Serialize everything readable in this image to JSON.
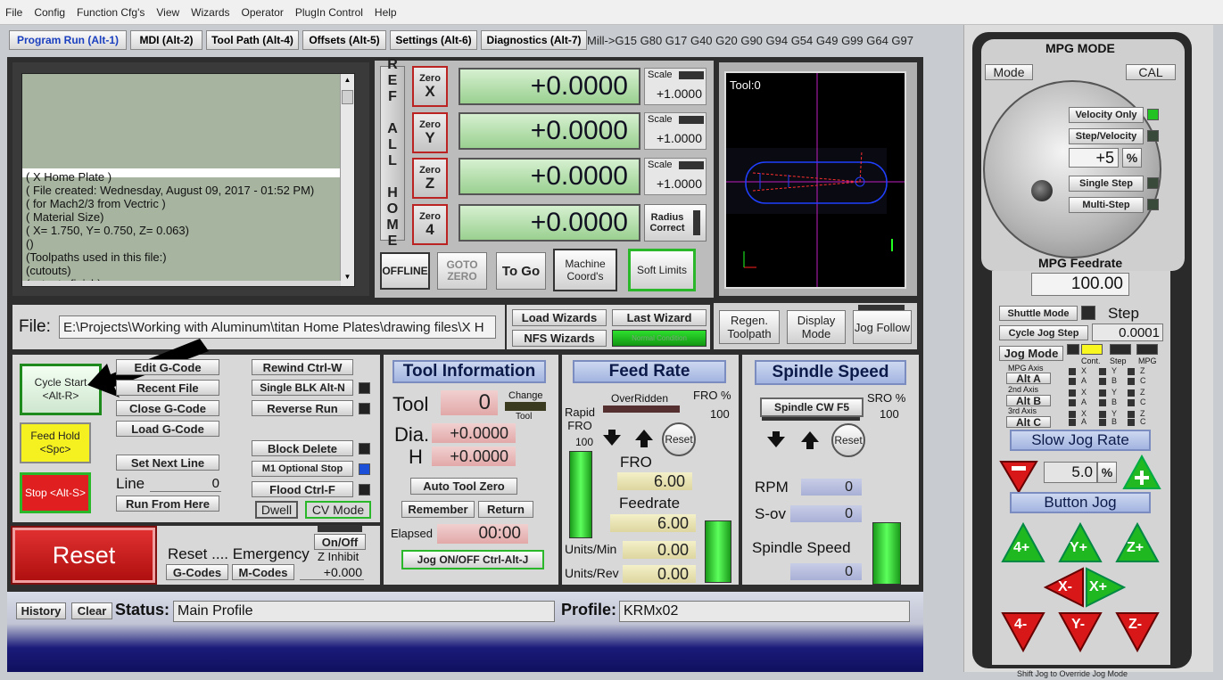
{
  "menu": [
    "File",
    "Config",
    "Function Cfg's",
    "View",
    "Wizards",
    "Operator",
    "PlugIn Control",
    "Help"
  ],
  "tabs": [
    "Program Run (Alt-1)",
    "MDI (Alt-2)",
    "Tool Path (Alt-4)",
    "Offsets (Alt-5)",
    "Settings (Alt-6)",
    "Diagnostics (Alt-7)"
  ],
  "gcodes": "Mill->G15  G80 G17 G40 G20 G90 G94 G54 G49 G99 G64 G97",
  "gcode_lines": [
    "( X Home Plate )",
    "( File created: Wednesday, August 09, 2017 - 01:52 PM)",
    "( for Mach2/3 from Vectric )",
    "( Material Size)",
    "( X= 1.750, Y= 0.750, Z= 0.063)",
    "()",
    "(Toolpaths used in this file:)",
    "(cutouts)",
    "(cutouts finish)"
  ],
  "ref_all_home": "REF ALL HOME",
  "axes": [
    {
      "zero": "Zero",
      "axis": "X",
      "value": "+0.0000",
      "scale": "+1.0000"
    },
    {
      "zero": "Zero",
      "axis": "Y",
      "value": "+0.0000",
      "scale": "+1.0000"
    },
    {
      "zero": "Zero",
      "axis": "Z",
      "value": "+0.0000",
      "scale": "+1.0000"
    },
    {
      "zero": "Zero",
      "axis": "4",
      "value": "+0.0000"
    }
  ],
  "scale_label": "Scale",
  "radius_correct": "Radius Correct",
  "dro_buttons": {
    "offline": "OFFLINE",
    "goto_zero": "GOTO ZERO",
    "to_go": "To Go",
    "machine_coord": "Machine Coord's",
    "soft_limits": "Soft Limits"
  },
  "toolpath": {
    "label": "Tool:0"
  },
  "file": {
    "label": "File:",
    "path": "E:\\Projects\\Working with Aluminum\\titan Home Plates\\drawing files\\X H"
  },
  "wizards": {
    "load": "Load Wizards",
    "last": "Last Wizard",
    "nfs": "NFS Wizards",
    "normal": "Normal Condition"
  },
  "view_buttons": {
    "regen": "Regen. Toolpath",
    "display": "Display Mode",
    "jog": "Jog Follow"
  },
  "program": {
    "cycle_start": "Cycle Start <Alt-R>",
    "feed_hold": "Feed Hold <Spc>",
    "stop": "Stop <Alt-S>",
    "edit": "Edit G-Code",
    "recent": "Recent File",
    "close": "Close G-Code",
    "load": "Load G-Code",
    "set_next": "Set Next Line",
    "line_label": "Line",
    "line_value": "0",
    "run_from": "Run From Here",
    "rewind": "Rewind Ctrl-W",
    "single_blk": "Single BLK Alt-N",
    "reverse": "Reverse Run",
    "block_delete": "Block Delete",
    "m1": "M1 Optional Stop",
    "flood": "Flood Ctrl-F",
    "dwell": "Dwell",
    "cv_mode": "CV Mode"
  },
  "reset": {
    "label": "Reset",
    "reset_codes": "Reset .... Emergency",
    "gcodes": "G-Codes",
    "mcodes": "M-Codes",
    "onoff": "On/Off",
    "z_inhibit": "Z Inhibit",
    "z_value": "+0.000"
  },
  "tool": {
    "title": "Tool Information",
    "tool_label": "Tool",
    "tool_value": "0",
    "change": "Change",
    "change_tool": "Tool",
    "dia_label": "Dia.",
    "dia_value": "+0.0000",
    "h_label": "H",
    "h_value": "+0.0000",
    "auto_zero": "Auto Tool Zero",
    "remember": "Remember",
    "return": "Return",
    "elapsed_label": "Elapsed",
    "elapsed_value": "00:00",
    "jog_onoff": "Jog ON/OFF Ctrl-Alt-J"
  },
  "feed": {
    "title": "Feed Rate",
    "overridden": "OverRidden",
    "fro_pct_label": "FRO %",
    "fro_pct": "100",
    "rapid": "Rapid FRO",
    "rapid_value": "100",
    "reset": "Reset",
    "fro_label": "FRO",
    "fro_value": "6.00",
    "feedrate_label": "Feedrate",
    "feedrate_value": "6.00",
    "units_min_label": "Units/Min",
    "units_min": "0.00",
    "units_rev_label": "Units/Rev",
    "units_rev": "0.00"
  },
  "spindle": {
    "title": "Spindle Speed",
    "cw": "Spindle CW F5",
    "sro_label": "SRO %",
    "sro": "100",
    "reset": "Reset",
    "rpm_label": "RPM",
    "rpm": "0",
    "sov_label": "S-ov",
    "sov": "0",
    "speed_label": "Spindle Speed",
    "speed": "0"
  },
  "status": {
    "history": "History",
    "clear": "Clear",
    "status_label": "Status:",
    "status_text": "Main Profile",
    "profile_label": "Profile:",
    "profile_text": "KRMx02"
  },
  "mpg": {
    "title": "MPG MODE",
    "mode": "Mode",
    "cal": "CAL",
    "velocity_only": "Velocity Only",
    "step_velocity": "Step/Velocity",
    "rate": "+5",
    "pct": "%",
    "single_step": "Single Step",
    "multi_step": "Multi-Step",
    "feedrate_title": "MPG Feedrate",
    "feedrate": "100.00",
    "shuttle": "Shuttle Mode",
    "step_label": "Step",
    "cycle_jog": "Cycle Jog Step",
    "step_value": "0.0001",
    "jog_mode": "Jog Mode",
    "cont": "Cont.",
    "step": "Step",
    "mpg": "MPG",
    "axis1": "MPG Axis",
    "alt_a": "Alt A",
    "axis2": "2nd Axis",
    "alt_b": "Alt B",
    "axis3": "3rd Axis",
    "alt_c": "Alt C",
    "slow_jog": "Slow Jog Rate",
    "jog_pct": "5.0",
    "button_jog": "Button Jog",
    "jog_buttons": [
      "4+",
      "Y+",
      "Z+",
      "X-",
      "X+",
      "4-",
      "Y-",
      "Z-"
    ],
    "footer": "Shift Jog to Override Jog Mode"
  }
}
